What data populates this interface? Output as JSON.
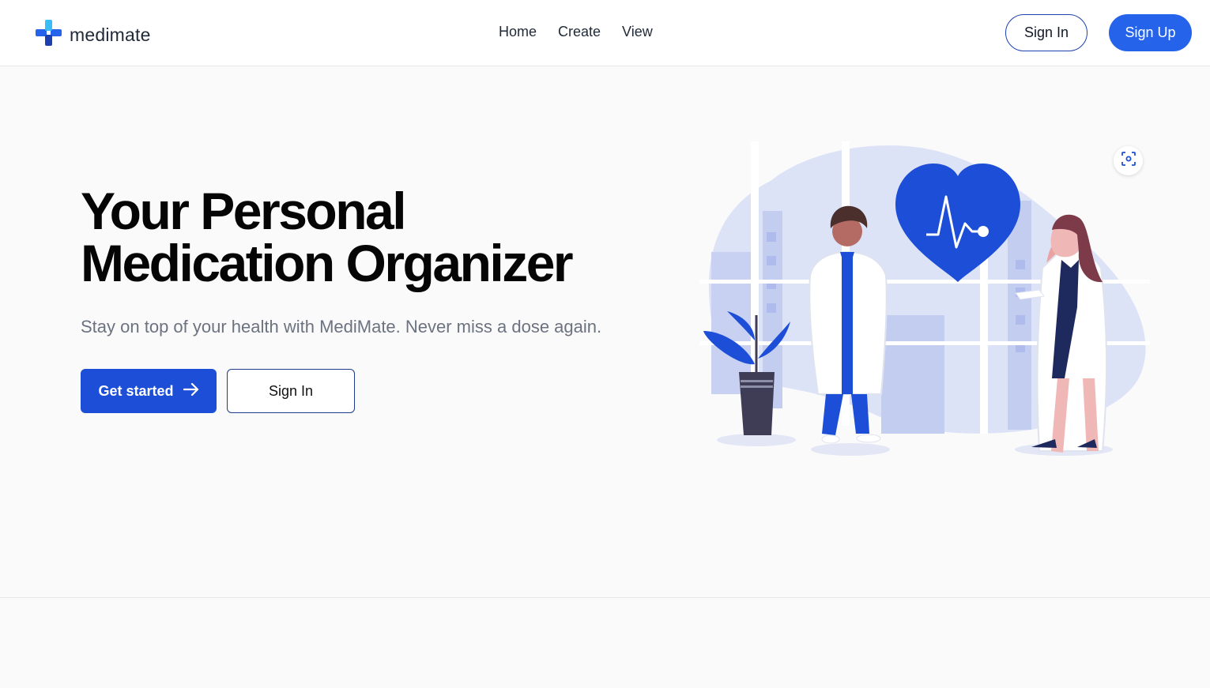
{
  "brand": {
    "name": "medimate",
    "logo_icon": "medical-cross-icon"
  },
  "nav": {
    "links": [
      "Home",
      "Create",
      "View"
    ],
    "signin_label": "Sign In",
    "signup_label": "Sign Up"
  },
  "hero": {
    "title_line1": "Your Personal",
    "title_line2": "Medication Organizer",
    "subtitle": "Stay on top of your health with MediMate. Never miss a dose again.",
    "primary_button": "Get started",
    "secondary_button": "Sign In"
  },
  "colors": {
    "primary": "#1d4ed8",
    "accent": "#2563eb",
    "text": "#050505",
    "muted": "#6b7280"
  }
}
